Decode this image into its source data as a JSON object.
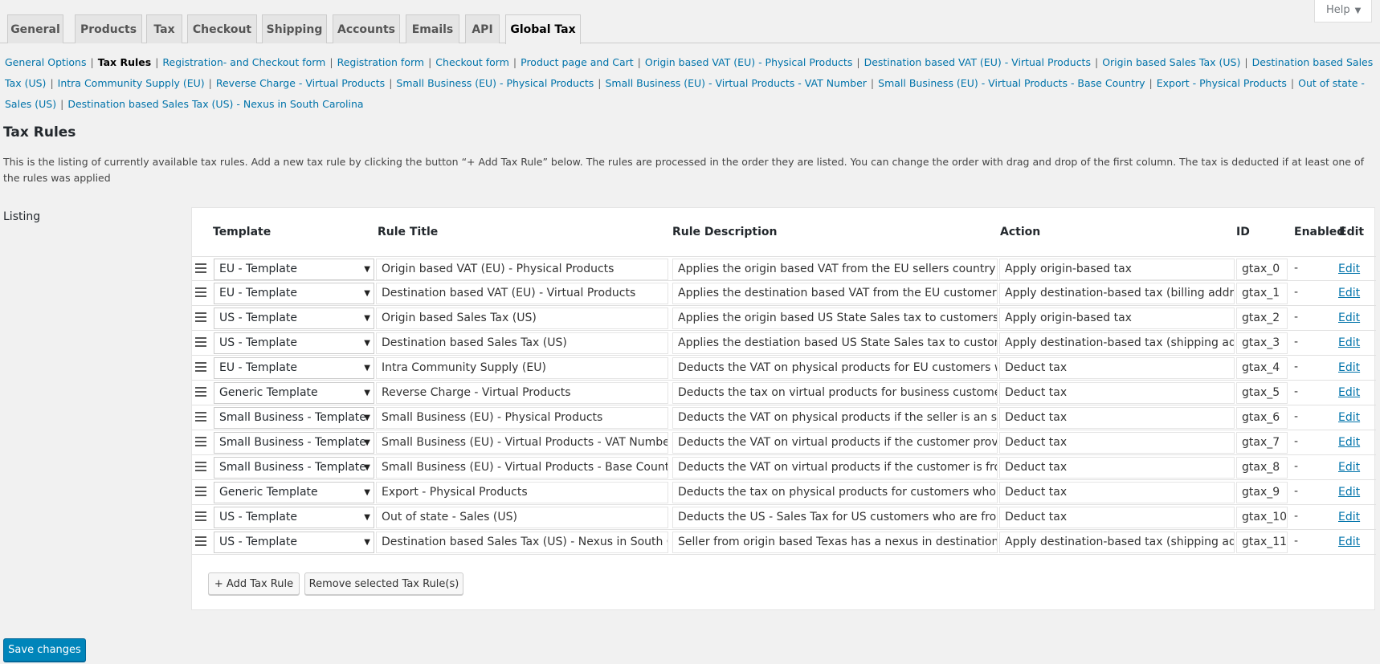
{
  "help": {
    "label": "Help"
  },
  "tabs": [
    {
      "label": "General"
    },
    {
      "label": "Products"
    },
    {
      "label": "Tax"
    },
    {
      "label": "Checkout"
    },
    {
      "label": "Shipping"
    },
    {
      "label": "Accounts"
    },
    {
      "label": "Emails"
    },
    {
      "label": "API"
    },
    {
      "label": "Global Tax"
    }
  ],
  "subnav": [
    "General Options",
    "Tax Rules",
    "Registration- and Checkout form",
    "Registration form",
    "Checkout form",
    "Product page and Cart",
    "Origin based VAT (EU) - Physical Products",
    "Destination based VAT (EU) - Virtual Products",
    "Origin based Sales Tax (US)",
    "Destination based Sales Tax (US)",
    "Intra Community Supply (EU)",
    "Reverse Charge - Virtual Products",
    "Small Business (EU) - Physical Products",
    "Small Business (EU) - Virtual Products - VAT Number",
    "Small Business (EU) - Virtual Products - Base Country",
    "Export - Physical Products",
    "Out of state - Sales (US)",
    "Destination based Sales Tax (US) - Nexus in South Carolina"
  ],
  "page": {
    "title": "Tax Rules",
    "description": "This is the listing of currently available tax rules. Add a new tax rule by clicking the button “+ Add Tax Rule” below. The rules are processed in the order they are listed. You can change the order with drag and drop of the first column. The tax is deducted if at least one of the rules was applied",
    "listing_label": "Listing"
  },
  "table": {
    "headers": {
      "template": "Template",
      "title": "Rule Title",
      "description": "Rule Description",
      "action": "Action",
      "id": "ID",
      "enabled": "Enabled",
      "edit": "Edit"
    },
    "rows": [
      {
        "template": "EU - Template",
        "title": "Origin based VAT (EU) - Physical Products",
        "description": "Applies the origin based VAT from the EU sellers country on p",
        "action": "Apply origin-based tax",
        "id": "gtax_0",
        "enabled": "-",
        "edit": "Edit"
      },
      {
        "template": "EU - Template",
        "title": "Destination based VAT (EU) - Virtual Products",
        "description": "Applies the destination based VAT from the EU customers co",
        "action": "Apply destination-based tax (billing address",
        "id": "gtax_1",
        "enabled": "-",
        "edit": "Edit"
      },
      {
        "template": "US - Template",
        "title": "Origin based Sales Tax (US)",
        "description": "Applies the origin based US State Sales tax to customers fror",
        "action": "Apply origin-based tax",
        "id": "gtax_2",
        "enabled": "-",
        "edit": "Edit"
      },
      {
        "template": "US - Template",
        "title": "Destination based Sales Tax (US)",
        "description": "Applies the destiation based US State Sales tax to customers",
        "action": "Apply destination-based tax (shipping addr",
        "id": "gtax_3",
        "enabled": "-",
        "edit": "Edit"
      },
      {
        "template": "EU - Template",
        "title": "Intra Community Supply (EU)",
        "description": "Deducts the VAT on physical products for EU customers who",
        "action": "Deduct tax",
        "id": "gtax_4",
        "enabled": "-",
        "edit": "Edit"
      },
      {
        "template": "Generic Template",
        "title": "Reverse Charge - Virtual Products",
        "description": "Deducts the tax on virtual products for business customers v",
        "action": "Deduct tax",
        "id": "gtax_5",
        "enabled": "-",
        "edit": "Edit"
      },
      {
        "template": "Small Business - Template",
        "title": "Small Business (EU) - Physical Products",
        "description": "Deducts the VAT on physical products if the seller is an small",
        "action": "Deduct tax",
        "id": "gtax_6",
        "enabled": "-",
        "edit": "Edit"
      },
      {
        "template": "Small Business - Template",
        "title": "Small Business (EU) - Virtual Products - VAT Number",
        "description": "Deducts the VAT on virtual products if the customer providec",
        "action": "Deduct tax",
        "id": "gtax_7",
        "enabled": "-",
        "edit": "Edit"
      },
      {
        "template": "Small Business - Template",
        "title": "Small Business (EU) - Virtual Products - Base Country",
        "description": "Deducts the VAT on virtual products if the customer is from t",
        "action": "Deduct tax",
        "id": "gtax_8",
        "enabled": "-",
        "edit": "Edit"
      },
      {
        "template": "Generic Template",
        "title": "Export - Physical Products",
        "description": "Deducts the tax on physical products for customers who are",
        "action": "Deduct tax",
        "id": "gtax_9",
        "enabled": "-",
        "edit": "Edit"
      },
      {
        "template": "US - Template",
        "title": "Out of state - Sales (US)",
        "description": "Deducts the US - Sales Tax for US customers who are from d",
        "action": "Deduct tax",
        "id": "gtax_10",
        "enabled": "-",
        "edit": "Edit"
      },
      {
        "template": "US - Template",
        "title": "Destination based Sales Tax (US) - Nexus in South Carc",
        "description": "Seller from origin based Texas has a nexus in destination bas",
        "action": "Apply destination-based tax (shipping addr",
        "id": "gtax_11",
        "enabled": "-",
        "edit": "Edit"
      }
    ]
  },
  "buttons": {
    "add_rule": "+ Add Tax Rule",
    "remove_rules": "Remove selected Tax Rule(s)",
    "save": "Save changes"
  },
  "colors": {
    "link": "#0073aa",
    "primary_button": "#0085ba",
    "page_bg": "#f1f1f1"
  }
}
